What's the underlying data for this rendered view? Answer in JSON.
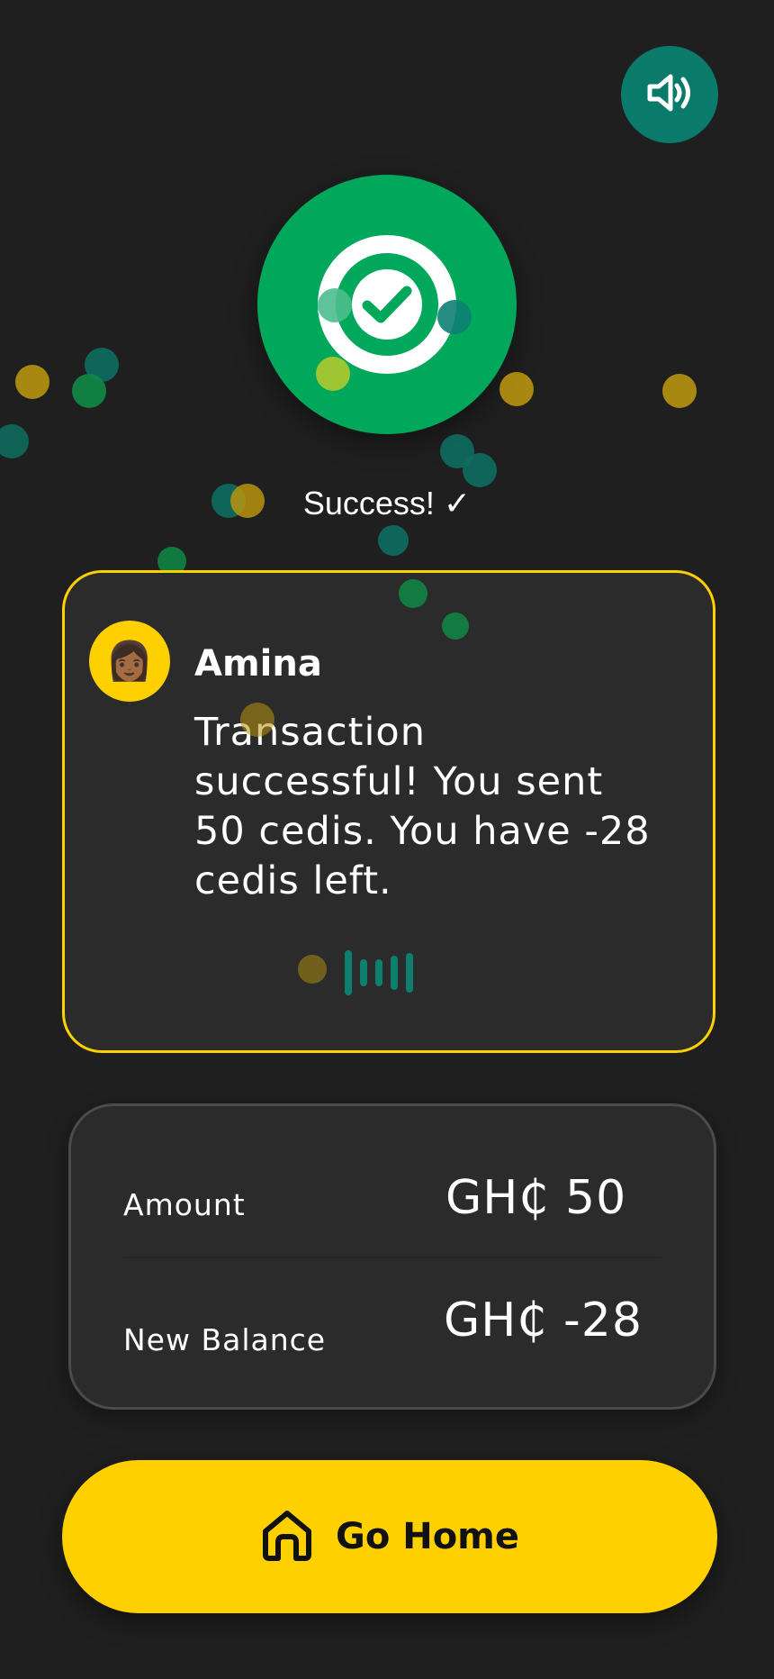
{
  "status": {
    "success_text": "Success! ✓"
  },
  "message_card": {
    "sender": "Amina",
    "avatar_emoji": "👩🏾",
    "message": "Transaction successful! You sent 50 cedis. You have -28 cedis left."
  },
  "summary": {
    "amount_label": "Amount",
    "amount_value": "GH₵ 50",
    "balance_label": "New Balance",
    "balance_value": "GH₵ -28"
  },
  "home_button": {
    "label": "Go Home"
  },
  "icons": {
    "sound": "speaker-volume-icon",
    "success": "check-circle-icon",
    "home": "home-icon",
    "audio": "audio-waveform-icon"
  },
  "colors": {
    "background": "#1f1f1f",
    "success_green": "#01a85b",
    "accent_yellow": "#ffd000",
    "teal": "#0a7a6a",
    "card": "#2b2b2b"
  }
}
